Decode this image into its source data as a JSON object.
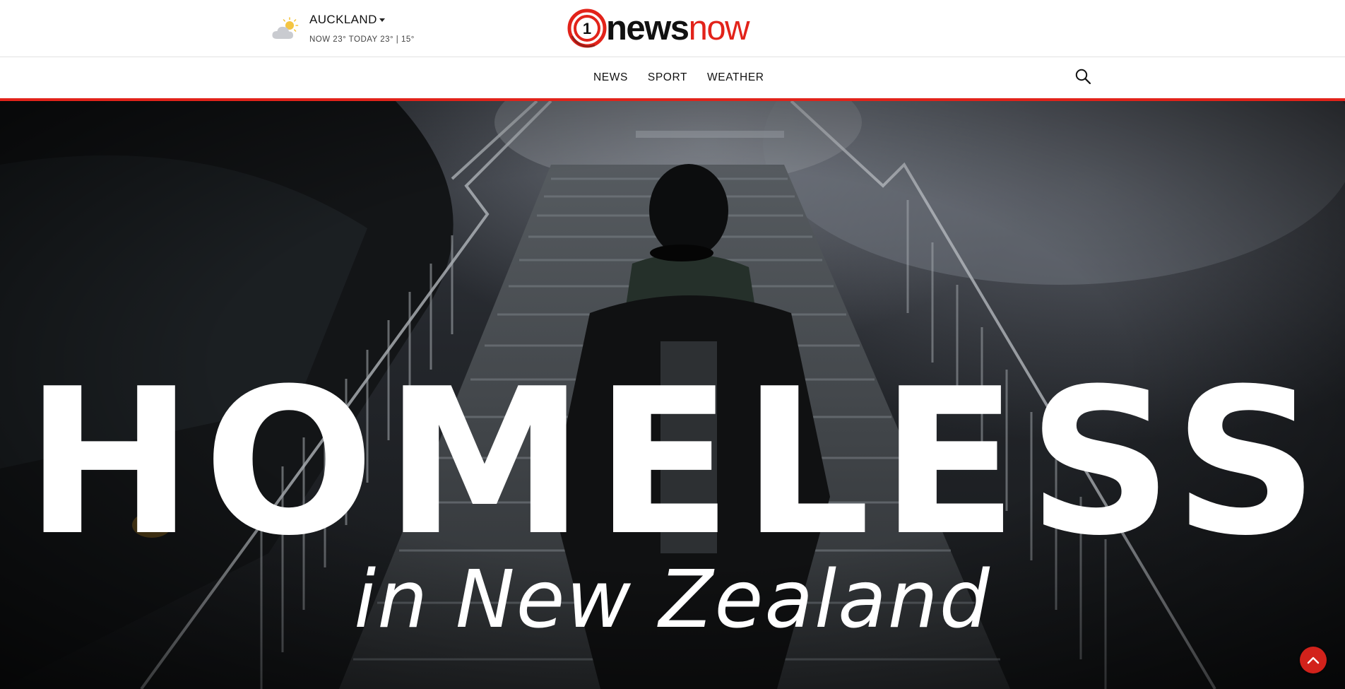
{
  "weather": {
    "city": "AUCKLAND",
    "conditions_line": "NOW 23° TODAY 23° | 15°",
    "icon": "partly-cloudy-icon"
  },
  "brand": {
    "badge": "1",
    "word_news": "news",
    "word_now": "now",
    "colors": {
      "accent": "#e2231a",
      "text": "#111111"
    }
  },
  "nav": {
    "items": [
      {
        "label": "NEWS"
      },
      {
        "label": "SPORT"
      },
      {
        "label": "WEATHER"
      }
    ],
    "search_icon": "search-icon"
  },
  "hero": {
    "title": "HOMELESS",
    "subtitle": "in New Zealand"
  },
  "back_to_top": {
    "icon": "chevron-up-icon",
    "color": "#d2221b"
  }
}
